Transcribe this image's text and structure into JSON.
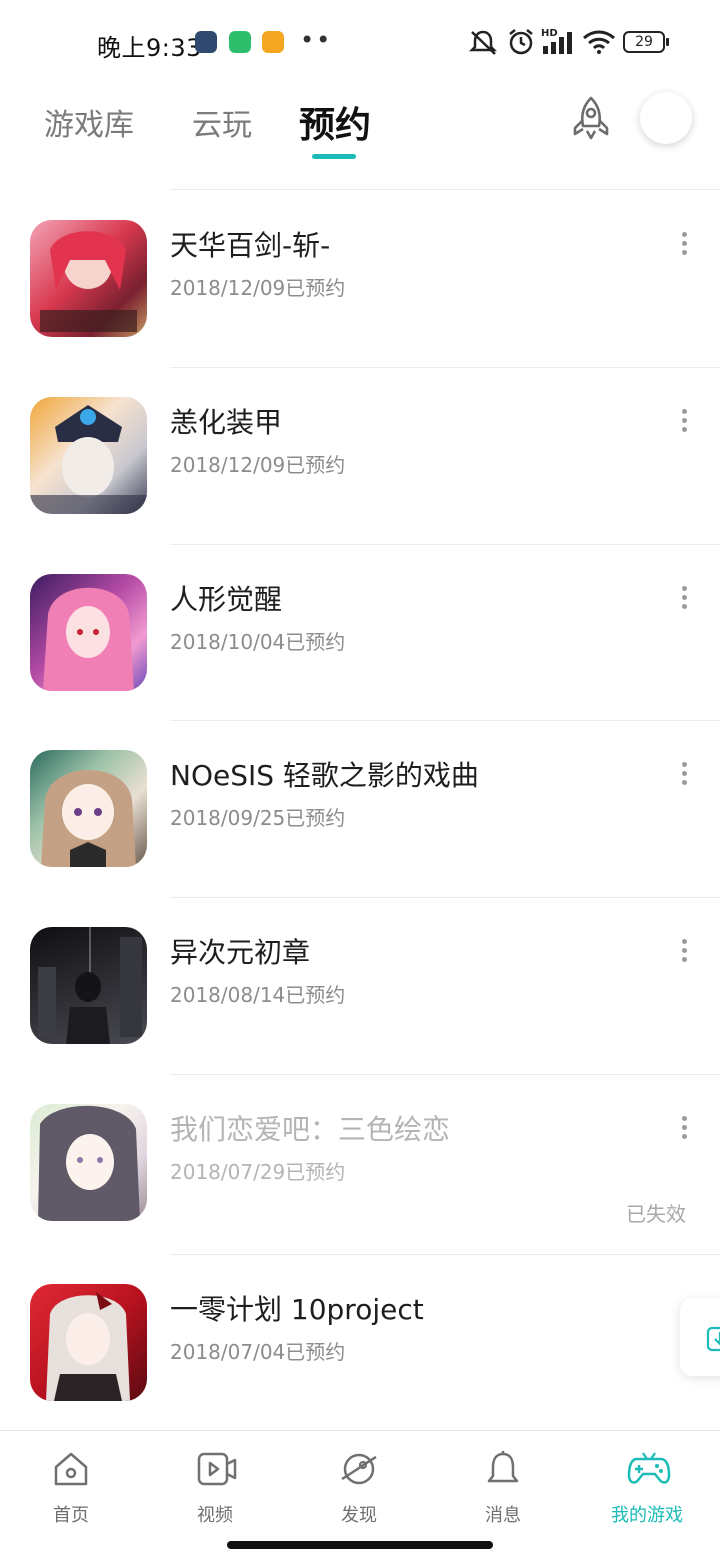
{
  "status_bar": {
    "time": "晚上9:33",
    "dots": "••",
    "battery": "29",
    "network": "HD"
  },
  "tabs": [
    {
      "label": "游戏库"
    },
    {
      "label": "云玩"
    },
    {
      "label": "预约"
    }
  ],
  "active_tab": "预约",
  "accent_color": "#1bbcb7",
  "games": [
    {
      "name": "天华百剑-斩-",
      "date": "2018/12/09已预约"
    },
    {
      "name": "恙化装甲",
      "date": "2018/12/09已预约"
    },
    {
      "name": "人形觉醒",
      "date": "2018/10/04已预约"
    },
    {
      "name": "NOeSIS 轻歌之影的戏曲",
      "date": "2018/09/25已预约"
    },
    {
      "name": "异次元初章",
      "date": "2018/08/14已预约"
    },
    {
      "name": "我们恋爱吧：三色绘恋",
      "date": "2018/07/29已预约",
      "status": "已失效"
    },
    {
      "name": "一零计划 10project",
      "date": "2018/07/04已预约"
    }
  ],
  "bottom_nav": [
    {
      "label": "首页",
      "icon": "home-icon"
    },
    {
      "label": "视频",
      "icon": "video-icon"
    },
    {
      "label": "发现",
      "icon": "planet-icon"
    },
    {
      "label": "消息",
      "icon": "bell-icon"
    },
    {
      "label": "我的游戏",
      "icon": "gamepad-icon"
    }
  ]
}
